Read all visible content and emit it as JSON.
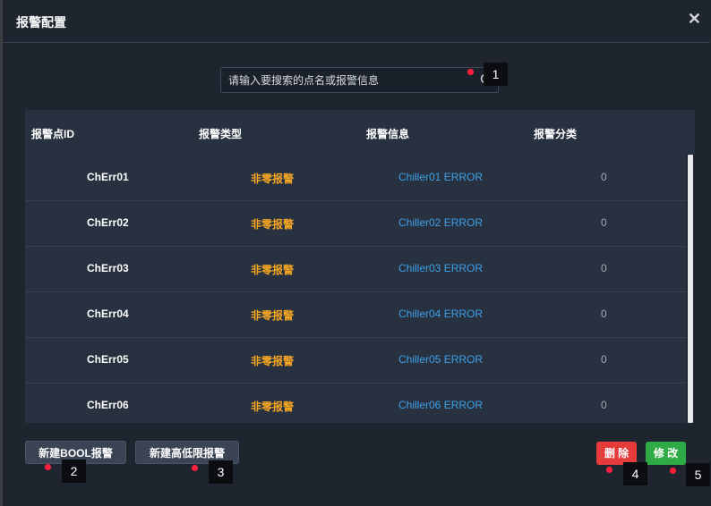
{
  "dialog": {
    "title": "报警配置",
    "close_glyph": "✕"
  },
  "search": {
    "placeholder": "请输入要搜索的点名或报警信息",
    "value": "",
    "icon": "search-icon"
  },
  "table": {
    "headers": [
      "报警点ID",
      "报警类型",
      "报警信息",
      "报警分类"
    ],
    "rows": [
      {
        "id": "ChErr01",
        "type": "非零报警",
        "message": "Chiller01 ERROR",
        "category": "0"
      },
      {
        "id": "ChErr02",
        "type": "非零报警",
        "message": "Chiller02 ERROR",
        "category": "0"
      },
      {
        "id": "ChErr03",
        "type": "非零报警",
        "message": "Chiller03 ERROR",
        "category": "0"
      },
      {
        "id": "ChErr04",
        "type": "非零报警",
        "message": "Chiller04 ERROR",
        "category": "0"
      },
      {
        "id": "ChErr05",
        "type": "非零报警",
        "message": "Chiller05 ERROR",
        "category": "0"
      },
      {
        "id": "ChErr06",
        "type": "非零报警",
        "message": "Chiller06 ERROR",
        "category": "0"
      }
    ]
  },
  "buttons": {
    "new_bool": "新建BOOL报警",
    "new_hilo": "新建高低限报警",
    "delete": "删 除",
    "modify": "修 改"
  },
  "markers": [
    "1",
    "2",
    "3",
    "4",
    "5"
  ],
  "colors": {
    "alarm_type": "#f5a623",
    "alarm_message": "#3fa0e8",
    "delete": "#e53b3b",
    "modify": "#2eab44",
    "marker_dot": "#ff1f3a"
  }
}
